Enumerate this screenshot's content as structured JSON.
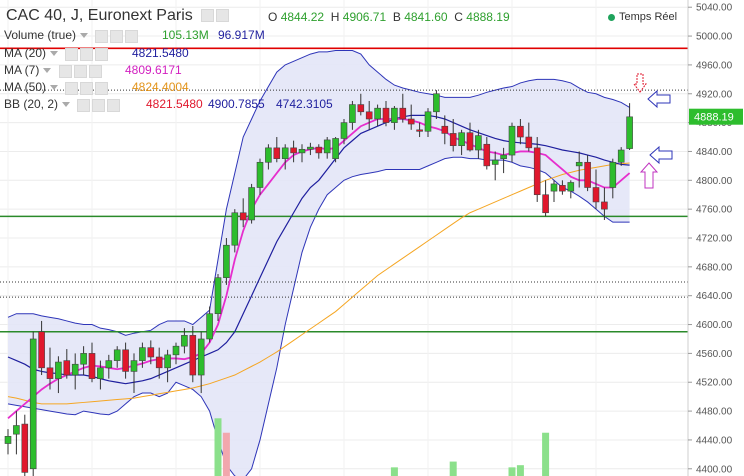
{
  "header": {
    "symbol": "CAC 40, J, Euronext Paris",
    "o_label": "O",
    "o_value": "4844.22",
    "h_label": "H",
    "h_value": "4906.71",
    "b_label": "B",
    "b_value": "4841.60",
    "c_label": "C",
    "c_value": "4888.19",
    "realtime": "Temps Réel"
  },
  "indicators": {
    "volume": {
      "label": "Volume (true)",
      "v1": "105.13M",
      "v2": "96.917M"
    },
    "ma20": {
      "label": "MA (20)",
      "value": "4821.5480"
    },
    "ma7": {
      "label": "MA (7)",
      "value": "4809.6171"
    },
    "ma50": {
      "label": "MA (50)",
      "value": "4824.4004"
    },
    "bb": {
      "label": "BB (20, 2)",
      "v1": "4821.5480",
      "v2": "4900.7855",
      "v3": "4742.3105"
    }
  },
  "colors": {
    "up": "#2dbd2d",
    "down": "#e0182d",
    "ma20": "#1f1f9e",
    "ma7": "#e62ecd",
    "ma50": "#f5a623",
    "bb_fill": "#e3e5f7",
    "bb_line": "#2e35b8",
    "hline_red": "#e00000",
    "hline_green": "#2a8a2a",
    "last_price": "#2dbd2d",
    "volume": "#8be08b",
    "volume_down": "#f2a7ad"
  },
  "chart_data": {
    "type": "candlestick",
    "ylim": [
      4390,
      5050
    ],
    "yticks": [
      4400,
      4440,
      4480,
      4520,
      4560,
      4600,
      4640,
      4680,
      4720,
      4760,
      4800,
      4840,
      4880,
      4920,
      4960,
      5000,
      5040
    ],
    "last_price": {
      "value": 4888.19,
      "label": "4888.19"
    },
    "hlines": [
      {
        "value": 4983,
        "style": "solid",
        "color": "red"
      },
      {
        "value": 4925,
        "style": "dotted",
        "color": "black"
      },
      {
        "value": 4750,
        "style": "solid",
        "color": "green"
      },
      {
        "value": 4659,
        "style": "dotted",
        "color": "black"
      },
      {
        "value": 4638,
        "style": "dotted",
        "color": "black"
      },
      {
        "value": 4590,
        "style": "solid",
        "color": "green"
      }
    ],
    "candles": [
      [
        4435,
        4455,
        4420,
        4445
      ],
      [
        4448,
        4480,
        4420,
        4460
      ],
      [
        4462,
        4475,
        4385,
        4395
      ],
      [
        4400,
        4590,
        4380,
        4580
      ],
      [
        4590,
        4605,
        4530,
        4540
      ],
      [
        4540,
        4568,
        4510,
        4525
      ],
      [
        4525,
        4556,
        4505,
        4548
      ],
      [
        4550,
        4566,
        4525,
        4530
      ],
      [
        4530,
        4560,
        4510,
        4545
      ],
      [
        4545,
        4570,
        4530,
        4560
      ],
      [
        4560,
        4575,
        4520,
        4525
      ],
      [
        4525,
        4550,
        4510,
        4540
      ],
      [
        4540,
        4558,
        4525,
        4550
      ],
      [
        4550,
        4570,
        4540,
        4565
      ],
      [
        4565,
        4575,
        4525,
        4535
      ],
      [
        4535,
        4560,
        4505,
        4550
      ],
      [
        4550,
        4575,
        4540,
        4568
      ],
      [
        4568,
        4578,
        4545,
        4555
      ],
      [
        4555,
        4568,
        4525,
        4540
      ],
      [
        4540,
        4565,
        4520,
        4558
      ],
      [
        4558,
        4575,
        4545,
        4570
      ],
      [
        4570,
        4595,
        4560,
        4585
      ],
      [
        4585,
        4598,
        4520,
        4530
      ],
      [
        4530,
        4590,
        4505,
        4580
      ],
      [
        4580,
        4625,
        4575,
        4615
      ],
      [
        4615,
        4670,
        4605,
        4665
      ],
      [
        4665,
        4720,
        4655,
        4710
      ],
      [
        4710,
        4760,
        4700,
        4755
      ],
      [
        4755,
        4775,
        4735,
        4745
      ],
      [
        4745,
        4795,
        4740,
        4790
      ],
      [
        4790,
        4830,
        4780,
        4825
      ],
      [
        4825,
        4850,
        4815,
        4845
      ],
      [
        4845,
        4860,
        4825,
        4830
      ],
      [
        4830,
        4850,
        4815,
        4845
      ],
      [
        4845,
        4855,
        4825,
        4838
      ],
      [
        4838,
        4850,
        4825,
        4843
      ],
      [
        4843,
        4852,
        4835,
        4846
      ],
      [
        4846,
        4850,
        4830,
        4838
      ],
      [
        4838,
        4860,
        4830,
        4856
      ],
      [
        4830,
        4860,
        4825,
        4858
      ],
      [
        4858,
        4885,
        4850,
        4880
      ],
      [
        4880,
        4910,
        4870,
        4905
      ],
      [
        4905,
        4920,
        4890,
        4895
      ],
      [
        4895,
        4910,
        4870,
        4885
      ],
      [
        4885,
        4905,
        4875,
        4900
      ],
      [
        4900,
        4910,
        4875,
        4880
      ],
      [
        4880,
        4903,
        4870,
        4900
      ],
      [
        4900,
        4920,
        4880,
        4885
      ],
      [
        4885,
        4905,
        4870,
        4878
      ],
      [
        4870,
        4880,
        4860,
        4868
      ],
      [
        4868,
        4900,
        4860,
        4895
      ],
      [
        4895,
        4925,
        4885,
        4920
      ],
      [
        4875,
        4890,
        4850,
        4865
      ],
      [
        4865,
        4885,
        4840,
        4848
      ],
      [
        4848,
        4870,
        4835,
        4866
      ],
      [
        4866,
        4880,
        4840,
        4842
      ],
      [
        4842,
        4870,
        4830,
        4862
      ],
      [
        4850,
        4860,
        4815,
        4820
      ],
      [
        4822,
        4840,
        4800,
        4828
      ],
      [
        4830,
        4845,
        4810,
        4835
      ],
      [
        4835,
        4880,
        4825,
        4875
      ],
      [
        4875,
        4885,
        4850,
        4860
      ],
      [
        4860,
        4880,
        4840,
        4845
      ],
      [
        4845,
        4860,
        4770,
        4780
      ],
      [
        4780,
        4800,
        4750,
        4755
      ],
      [
        4785,
        4800,
        4770,
        4795
      ],
      [
        4793,
        4800,
        4780,
        4785
      ],
      [
        4785,
        4800,
        4775,
        4797
      ],
      [
        4820,
        4840,
        4790,
        4825
      ],
      [
        4825,
        4835,
        4785,
        4790
      ],
      [
        4790,
        4815,
        4760,
        4770
      ],
      [
        4770,
        4790,
        4745,
        4760
      ],
      [
        4790,
        4830,
        4775,
        4825
      ],
      [
        4825,
        4846,
        4820,
        4842
      ],
      [
        4844,
        4907,
        4842,
        4888
      ]
    ],
    "bb_upper": [
      4610,
      4615,
      4615,
      4615,
      4612,
      4610,
      4608,
      4605,
      4602,
      4600,
      4600,
      4595,
      4593,
      4590,
      4585,
      4588,
      4590,
      4592,
      4600,
      4605,
      4605,
      4605,
      4600,
      4610,
      4620,
      4690,
      4760,
      4810,
      4860,
      4885,
      4910,
      4930,
      4950,
      4960,
      4965,
      4970,
      4975,
      4978,
      4978,
      4980,
      4980,
      4980,
      4975,
      4960,
      4950,
      4940,
      4932,
      4928,
      4925,
      4922,
      4920,
      4918,
      4915,
      4915,
      4915,
      4915,
      4918,
      4922,
      4925,
      4928,
      4930,
      4935,
      4938,
      4940,
      4940,
      4940,
      4938,
      4935,
      4928,
      4922,
      4920,
      4915,
      4912,
      4908,
      4901
    ],
    "bb_lower": [
      4490,
      4488,
      4486,
      4484,
      4482,
      4480,
      4478,
      4476,
      4475,
      4480,
      4478,
      4476,
      4475,
      4480,
      4490,
      4500,
      4505,
      4505,
      4500,
      4505,
      4520,
      4515,
      4510,
      4500,
      4480,
      4440,
      4405,
      4390,
      4385,
      4400,
      4440,
      4490,
      4540,
      4600,
      4650,
      4700,
      4735,
      4760,
      4780,
      4790,
      4800,
      4805,
      4808,
      4810,
      4812,
      4815,
      4815,
      4815,
      4815,
      4815,
      4820,
      4825,
      4830,
      4832,
      4832,
      4830,
      4830,
      4828,
      4828,
      4828,
      4825,
      4820,
      4818,
      4815,
      4810,
      4800,
      4790,
      4785,
      4778,
      4770,
      4760,
      4750,
      4742,
      4742,
      4742
    ],
    "ma20": [
      4555,
      4550,
      4545,
      4538,
      4535,
      4533,
      4532,
      4530,
      4530,
      4530,
      4528,
      4525,
      4522,
      4520,
      4518,
      4520,
      4522,
      4525,
      4530,
      4535,
      4540,
      4545,
      4550,
      4555,
      4560,
      4565,
      4575,
      4590,
      4615,
      4640,
      4665,
      4690,
      4715,
      4735,
      4755,
      4775,
      4790,
      4800,
      4815,
      4830,
      4845,
      4855,
      4865,
      4870,
      4875,
      4880,
      4885,
      4888,
      4890,
      4890,
      4890,
      4888,
      4885,
      4880,
      4875,
      4870,
      4866,
      4862,
      4858,
      4855,
      4853,
      4852,
      4851,
      4850,
      4848,
      4845,
      4842,
      4840,
      4838,
      4835,
      4832,
      4828,
      4825,
      4822,
      4821
    ],
    "ma7": [
      4470,
      4480,
      4490,
      4500,
      4510,
      4518,
      4525,
      4530,
      4535,
      4540,
      4543,
      4542,
      4540,
      4538,
      4540,
      4543,
      4546,
      4550,
      4552,
      4553,
      4553,
      4552,
      4555,
      4560,
      4575,
      4600,
      4640,
      4690,
      4730,
      4760,
      4780,
      4795,
      4810,
      4825,
      4835,
      4840,
      4843,
      4845,
      4843,
      4845,
      4855,
      4865,
      4875,
      4880,
      4885,
      4885,
      4885,
      4885,
      4883,
      4880,
      4875,
      4872,
      4868,
      4860,
      4855,
      4850,
      4845,
      4840,
      4838,
      4835,
      4838,
      4840,
      4840,
      4838,
      4835,
      4825,
      4815,
      4805,
      4800,
      4800,
      4795,
      4790,
      4790,
      4800,
      4810
    ],
    "ma50": [
      4500,
      4498,
      4495,
      4492,
      4490,
      4490,
      4490,
      4490,
      4491,
      4492,
      4493,
      4494,
      4495,
      4496,
      4497,
      4498,
      4500,
      4502,
      4504,
      4506,
      4508,
      4510,
      4512,
      4515,
      4518,
      4522,
      4526,
      4530,
      4536,
      4542,
      4548,
      4555,
      4562,
      4570,
      4578,
      4586,
      4594,
      4602,
      4610,
      4618,
      4628,
      4638,
      4648,
      4658,
      4668,
      4676,
      4684,
      4692,
      4700,
      4708,
      4716,
      4724,
      4732,
      4740,
      4748,
      4755,
      4760,
      4765,
      4770,
      4775,
      4780,
      4785,
      4790,
      4795,
      4800,
      4804,
      4808,
      4811,
      4814,
      4816,
      4818,
      4820,
      4822,
      4823,
      4824
    ],
    "volume": [
      0,
      0,
      0,
      0,
      0,
      0,
      0,
      0,
      0,
      0,
      0,
      0,
      0,
      0,
      0,
      0,
      0,
      0,
      0,
      0,
      0,
      0,
      0,
      0,
      0,
      0,
      0,
      0,
      0,
      0,
      0,
      0,
      0,
      0,
      0,
      0,
      0,
      0,
      0,
      0,
      0,
      0,
      0,
      0,
      0,
      0,
      0,
      0,
      0,
      0,
      0,
      0,
      0,
      0,
      0,
      0,
      0,
      0,
      0,
      0,
      0,
      0,
      0,
      0,
      0,
      0,
      0,
      0,
      0,
      0,
      0,
      0,
      0,
      0,
      0
    ]
  }
}
